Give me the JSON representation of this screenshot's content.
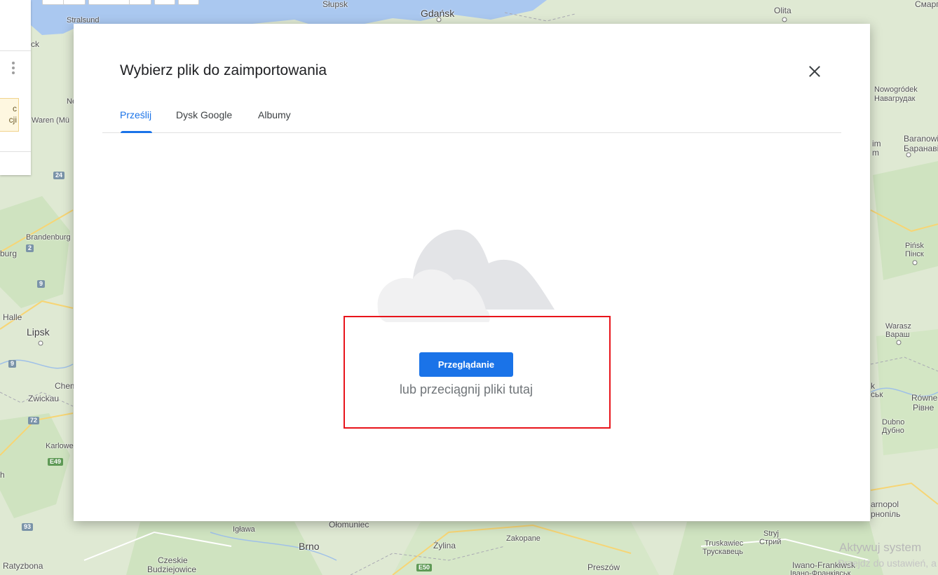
{
  "dialog": {
    "title": "Wybierz plik do zaimportowania",
    "close_icon": "close-icon",
    "tabs": [
      {
        "label": "Prześlij",
        "active": true
      },
      {
        "label": "Dysk Google",
        "active": false
      },
      {
        "label": "Albumy",
        "active": false
      }
    ],
    "illustration_icon": "cloud-icon",
    "browse_label": "Przeglądanie",
    "drop_hint": "lub przeciągnij pliki tutaj"
  },
  "side_panel": {
    "note_line1": "c",
    "note_line2": "cji",
    "menu_icon": "more-vert-icon"
  },
  "map": {
    "labels": {
      "slupsk": "Słupsk",
      "gdansk": "Gdańsk",
      "olita": "Olita",
      "smarh": "Смарг",
      "stralsund": "Stralsund",
      "ck": "ck",
      "nowogrodek": "Nowogródek",
      "nowogrodek_cy": "Навагрудак",
      "ne": "Ne",
      "waren": "Waren (Mü",
      "baranowicze": "Baranowicze",
      "baranowicze_cy": "Баранавічы",
      "im": "im",
      "m": "m",
      "brandenburg": "Brandenburg",
      "burg": "burg",
      "pinsk": "Pińsk",
      "pinsk_cy": "Пінск",
      "halle": "Halle",
      "lipsk": "Lipsk",
      "warasz": "Warasz",
      "warasz_cy": "Вараш",
      "chem": "Chem",
      "zwickau": "Zwickau",
      "k": "k",
      "sk": "ськ",
      "rowne": "Równe",
      "rowne_cy": "Рівне",
      "karlowe": "Karlowe",
      "dubno": "Dubno",
      "dubno_cy": "Дубно",
      "h": "h",
      "tarnopol": "arnopol",
      "tarnopol_cy": "рнопіль",
      "iglawa": "Igława",
      "olomuniec": "Ołomuniec",
      "stryj": "Stryj",
      "stryj_cy": "Стрий",
      "brno": "Brno",
      "zylina": "Żylina",
      "zakopane": "Zakopane",
      "truskawiec": "Truskawiec",
      "truskawiec_cy": "Трускавець",
      "ratyzbona": "Ratyzbona",
      "czeskie": "Czeskie",
      "budziejowice": "Budziejowice",
      "preszow": "Preszów",
      "iwano": "Iwano-Frankiwsk",
      "iwano_cy": "Івано-Франківськ",
      "activate_1": "Aktywuj system",
      "activate_2": "Przejdź do ustawień, a"
    },
    "roads": [
      "24",
      "2",
      "9",
      "9",
      "72",
      "E49",
      "93",
      "E50"
    ]
  },
  "colors": {
    "accent": "#1a73e8",
    "highlight": "#e8141b",
    "map_land": "#dfe9d3",
    "map_water": "#aac8f0"
  }
}
